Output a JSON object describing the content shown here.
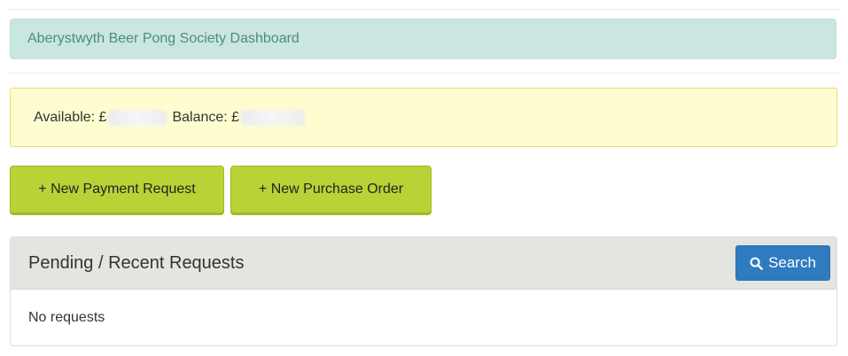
{
  "header": {
    "title": "Aberystwyth Beer Pong Society Dashboard"
  },
  "balances": {
    "available_label": "Available: £",
    "balance_label": "Balance: £"
  },
  "actions": {
    "new_payment_request": "+ New Payment Request",
    "new_purchase_order": "+ New Purchase Order"
  },
  "requests_panel": {
    "title": "Pending / Recent Requests",
    "search_label": "Search",
    "search_icon": "search-icon",
    "empty_message": "No requests"
  },
  "colors": {
    "title_bg": "#c9e6e0",
    "balance_bg": "#fefdd0",
    "action_button": "#b8d335",
    "search_button": "#2f7bbf"
  }
}
